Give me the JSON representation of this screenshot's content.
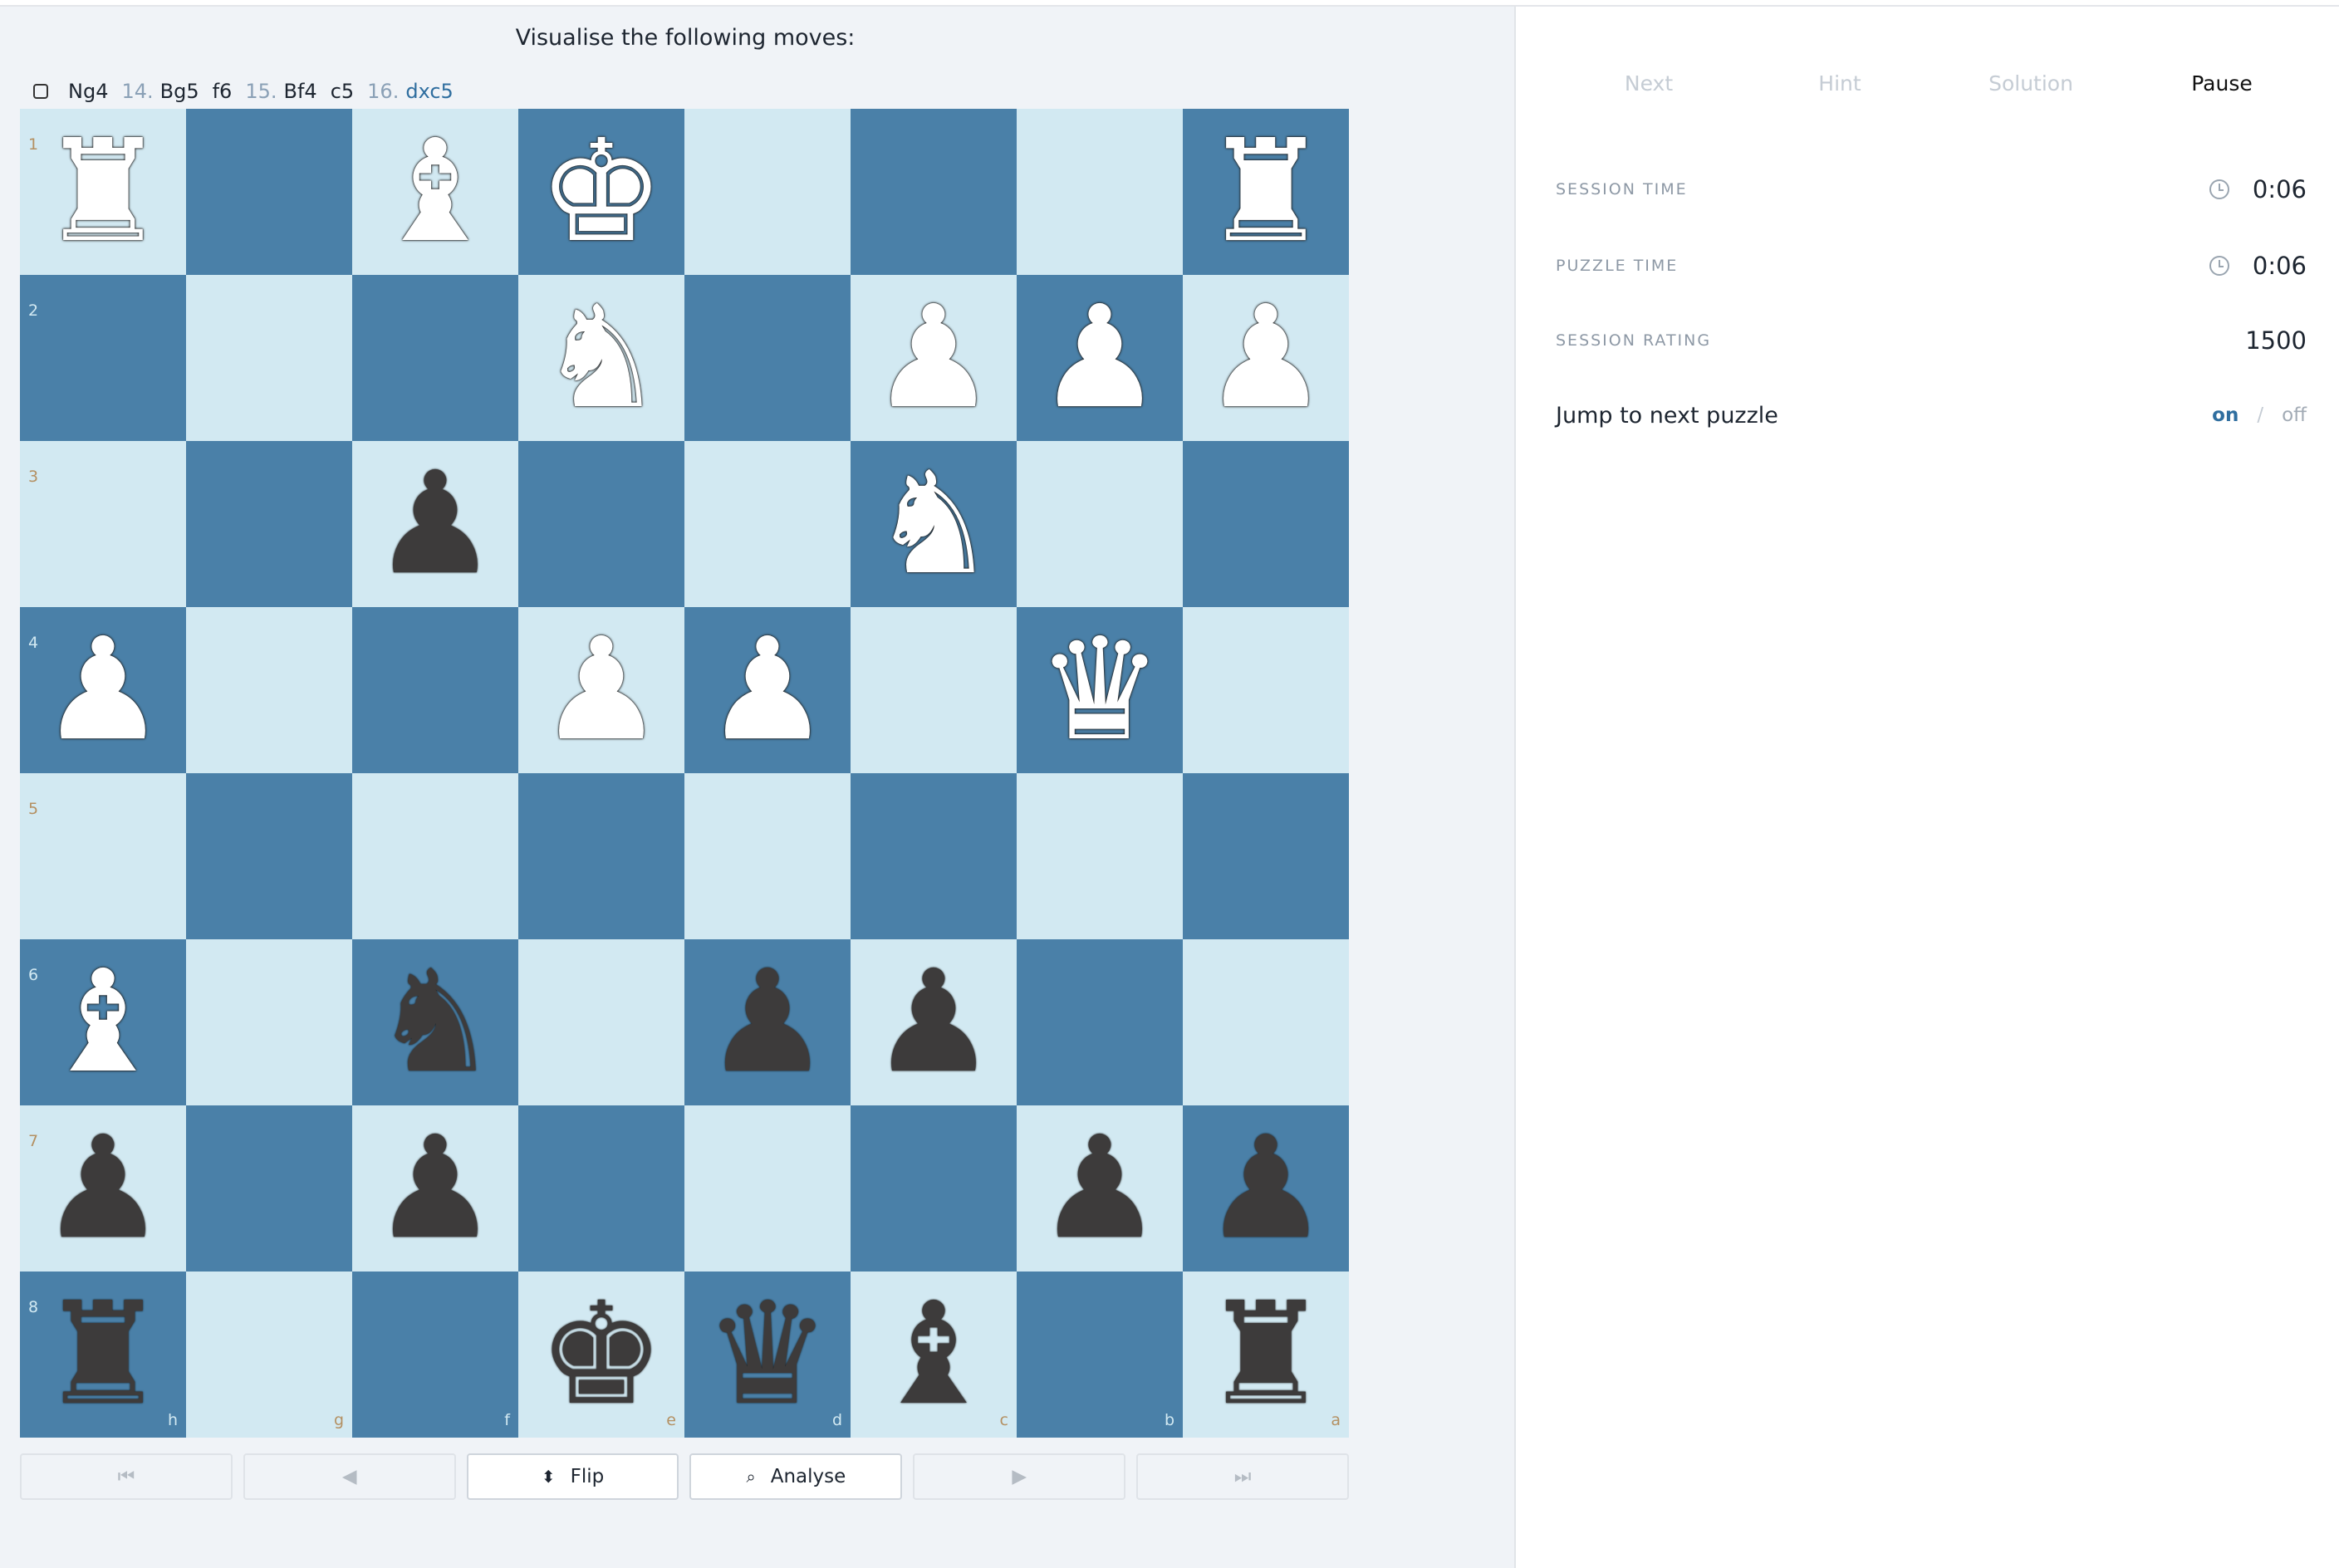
{
  "heading": "Visualise the following moves:",
  "moves": [
    {
      "num": "",
      "san": "Ng4"
    },
    {
      "num": "14.",
      "san": "Bg5"
    },
    {
      "num": "",
      "san": "f6"
    },
    {
      "num": "15.",
      "san": "Bf4"
    },
    {
      "num": "",
      "san": "c5"
    },
    {
      "num": "16.",
      "san": "dxc5",
      "current": true
    }
  ],
  "board": {
    "ranks": [
      "1",
      "2",
      "3",
      "4",
      "5",
      "6",
      "7",
      "8"
    ],
    "files": [
      "h",
      "g",
      "f",
      "e",
      "d",
      "c",
      "b",
      "a"
    ],
    "pieces": [
      [
        "wR",
        "",
        "wB",
        "wK",
        "",
        "",
        "",
        "wR"
      ],
      [
        "",
        "",
        "",
        "wN",
        "",
        "wP",
        "wP",
        "wP"
      ],
      [
        "",
        "",
        "bP",
        "",
        "",
        "wN",
        "",
        ""
      ],
      [
        "wP",
        "",
        "",
        "wP",
        "wP",
        "",
        "wQ",
        ""
      ],
      [
        "",
        "",
        "",
        "",
        "",
        "",
        "",
        ""
      ],
      [
        "wB",
        "",
        "bN",
        "",
        "bP",
        "bP",
        "",
        ""
      ],
      [
        "bP",
        "",
        "bP",
        "",
        "",
        "",
        "bP",
        "bP"
      ],
      [
        "bR",
        "",
        "",
        "bK",
        "bQ",
        "bB",
        "",
        "bR"
      ]
    ]
  },
  "controls": {
    "first_icon": "⏮",
    "prev_icon": "◀",
    "flip_icon": "⬍",
    "flip_label": "Flip",
    "analyse_icon": "⌕",
    "analyse_label": "Analyse",
    "next_icon": "▶",
    "last_icon": "⏭"
  },
  "actions": {
    "next": "Next",
    "hint": "Hint",
    "solution": "Solution",
    "pause": "Pause"
  },
  "stats": {
    "session_time_label": "SESSION TIME",
    "session_time_value": "0:06",
    "puzzle_time_label": "PUZZLE TIME",
    "puzzle_time_value": "0:06",
    "session_rating_label": "SESSION RATING",
    "session_rating_value": "1500"
  },
  "jump": {
    "label": "Jump to next puzzle",
    "on": "on",
    "sep": "/",
    "off": "off"
  }
}
